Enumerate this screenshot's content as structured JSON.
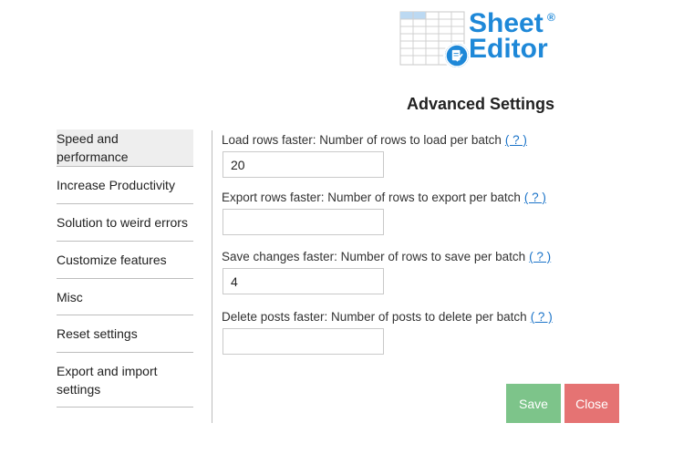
{
  "logo": {
    "line1": "Sheet",
    "line2": "Editor",
    "reg": "®",
    "icon": "sheet-editor-logo-icon",
    "brand_color": "#1e88d8"
  },
  "page": {
    "title": "Advanced Settings"
  },
  "sidebar": {
    "items": [
      {
        "label": "Speed and performance",
        "active": true
      },
      {
        "label": "Increase Productivity"
      },
      {
        "label": "Solution to weird errors"
      },
      {
        "label": "Customize features"
      },
      {
        "label": "Misc"
      },
      {
        "label": "Reset settings"
      },
      {
        "label": "Export and import settings"
      }
    ]
  },
  "fields": [
    {
      "label": "Load rows faster: Number of rows to load per batch",
      "help": "( ? )",
      "value": "20"
    },
    {
      "label": "Export rows faster: Number of rows to export per batch",
      "help": "( ? )",
      "value": ""
    },
    {
      "label": "Save changes faster: Number of rows to save per batch",
      "help": "( ? )",
      "value": "4"
    },
    {
      "label": "Delete posts faster: Number of posts to delete per batch",
      "help": "( ? )",
      "value": ""
    }
  ],
  "buttons": {
    "save": "Save",
    "close": "Close",
    "save_color": "#7dc48a",
    "close_color": "#e57373"
  }
}
